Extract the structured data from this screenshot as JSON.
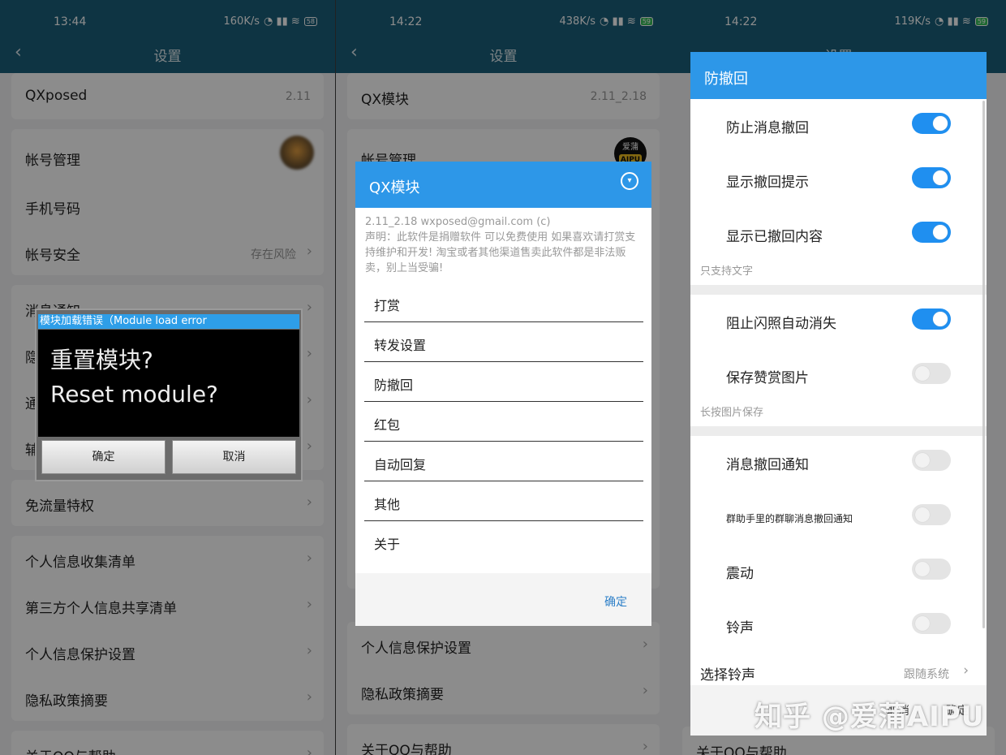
{
  "panel1": {
    "time": "13:44",
    "net": "160K/s",
    "battery": "58",
    "title": "设置",
    "app_name": "QXposed",
    "app_version": "2.11",
    "items": [
      {
        "label": "帐号管理"
      },
      {
        "label": "手机号码"
      },
      {
        "label": "帐号安全",
        "value": "存在风险"
      },
      {
        "label": "消息通知"
      },
      {
        "label": "隐"
      },
      {
        "label": "通"
      },
      {
        "label": "辅"
      },
      {
        "label": "免流量特权"
      },
      {
        "label": "个人信息收集清单"
      },
      {
        "label": "第三方个人信息共享清单"
      },
      {
        "label": "个人信息保护设置"
      },
      {
        "label": "隐私政策摘要"
      },
      {
        "label": "关于QQ与帮助"
      }
    ],
    "dialog": {
      "header": "模块加载错误（Module load error",
      "line1": "重置模块?",
      "line2": "Reset module?",
      "ok": "确定",
      "cancel": "取消"
    }
  },
  "panel2": {
    "time": "14:22",
    "net": "438K/s",
    "battery": "59",
    "title": "设置",
    "app_name": "QX模块",
    "app_version": "2.11_2.18",
    "account": "帐号管理",
    "avatar_text": "爱蒲",
    "avatar_badge": "AIPU",
    "bg_items": [
      "个人信息保护设置",
      "隐私政策摘要",
      "关于QQ与帮助"
    ],
    "dialog": {
      "title": "QX模块",
      "info1": "2.11_2.18 wxposed@gmail.com (c)",
      "info2": "声明：此软件是捐赠软件 可以免费使用 如果喜欢请打赏支持维护和开发! 淘宝或者其他渠道售卖此软件都是非法贩卖，别上当受骗!",
      "items": [
        "打赏",
        "转发设置",
        "防撤回",
        "红包",
        "自动回复",
        "其他",
        "关于"
      ],
      "ok": "确定"
    }
  },
  "panel3": {
    "time": "14:22",
    "net": "119K/s",
    "battery": "59",
    "bg_title": "设置",
    "bg_footer": "关于QQ与帮助",
    "dialog": {
      "title": "防撤回",
      "toggles1": [
        {
          "label": "防止消息撤回",
          "on": true
        },
        {
          "label": "显示撤回提示",
          "on": true
        },
        {
          "label": "显示已撤回内容",
          "on": true
        }
      ],
      "hint1": "只支持文字",
      "toggles2": [
        {
          "label": "阻止闪照自动消失",
          "on": true
        },
        {
          "label": "保存赞赏图片",
          "on": false
        }
      ],
      "hint2": "长按图片保存",
      "toggles3": [
        {
          "label": "消息撤回通知",
          "on": false
        },
        {
          "label": "群助手里的群聊消息撤回通知",
          "on": false
        },
        {
          "label": "震动",
          "on": false
        },
        {
          "label": "铃声",
          "on": false
        }
      ],
      "ringtone_label": "选择铃声",
      "ringtone_value": "跟随系统",
      "foot_cancel": "取消",
      "foot_ok": "确定"
    }
  },
  "watermark": "知乎 @爱蒲AIPU"
}
